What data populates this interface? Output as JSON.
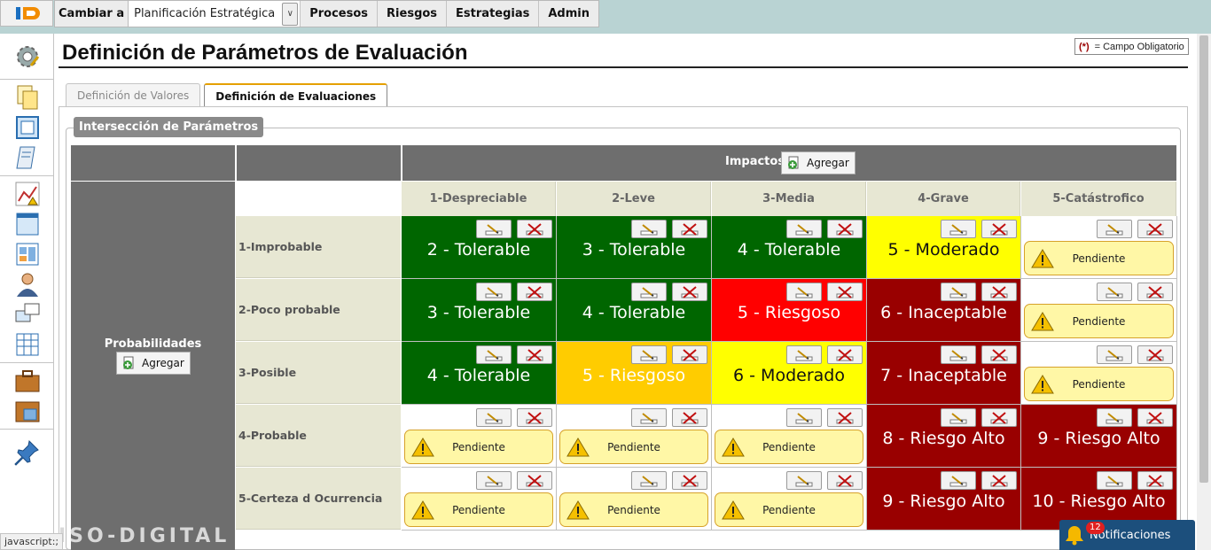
{
  "menu": {
    "cambiar_label": "Cambiar a",
    "selected_plan": "Planificación Estratégica",
    "items": [
      "Procesos",
      "Riesgos",
      "Estrategias",
      "Admin"
    ]
  },
  "page": {
    "title": "Definición de Parámetros de Evaluación",
    "required_marker": "(*)",
    "required_text": "= Campo Obligatorio"
  },
  "tabs": [
    {
      "label": "Definición de Valores",
      "active": false
    },
    {
      "label": "Definición de Evaluaciones",
      "active": true
    }
  ],
  "section": {
    "legend": "Intersección de Parámetros"
  },
  "matrix": {
    "impactos_label": "Impactos",
    "probabilidades_label": "Probabilidades",
    "agregar_label": "Agregar",
    "impactos": [
      "1-Despreciable",
      "2-Leve",
      "3-Media",
      "4-Grave",
      "5-Catástrofico"
    ],
    "probabilidades": [
      "1-Improbable",
      "2-Poco probable",
      "3-Posible",
      "4-Probable",
      "5-Certeza d Ocurrencia"
    ],
    "pending_label": "Pendiente",
    "rows": [
      [
        {
          "text": "2 - Tolerable",
          "bg": "#006600",
          "fg": "#ffffff"
        },
        {
          "text": "3 - Tolerable",
          "bg": "#006600",
          "fg": "#ffffff"
        },
        {
          "text": "4 - Tolerable",
          "bg": "#006600",
          "fg": "#ffffff"
        },
        {
          "text": "5 - Moderado",
          "bg": "#ffff00",
          "fg": "#111111"
        },
        {
          "pending": true
        }
      ],
      [
        {
          "text": "3 - Tolerable",
          "bg": "#006600",
          "fg": "#ffffff"
        },
        {
          "text": "4 - Tolerable",
          "bg": "#006600",
          "fg": "#ffffff"
        },
        {
          "text": "5 - Riesgoso",
          "bg": "#ff0000",
          "fg": "#ffffff"
        },
        {
          "text": "6 - Inaceptable",
          "bg": "#990000",
          "fg": "#ffffff"
        },
        {
          "pending": true
        }
      ],
      [
        {
          "text": "4 - Tolerable",
          "bg": "#006600",
          "fg": "#ffffff"
        },
        {
          "text": "5 - Riesgoso",
          "bg": "#ffcc00",
          "fg": "#ffffff"
        },
        {
          "text": "6 - Moderado",
          "bg": "#ffff00",
          "fg": "#111111"
        },
        {
          "text": "7 - Inaceptable",
          "bg": "#990000",
          "fg": "#ffffff"
        },
        {
          "pending": true
        }
      ],
      [
        {
          "pending": true
        },
        {
          "pending": true
        },
        {
          "pending": true
        },
        {
          "text": "8 - Riesgo Alto",
          "bg": "#990000",
          "fg": "#ffffff"
        },
        {
          "text": "9 - Riesgo Alto",
          "bg": "#990000",
          "fg": "#ffffff"
        }
      ],
      [
        {
          "pending": true
        },
        {
          "pending": true
        },
        {
          "pending": true
        },
        {
          "text": "9 - Riesgo Alto",
          "bg": "#990000",
          "fg": "#ffffff"
        },
        {
          "text": "10 - Riesgo Alto",
          "bg": "#990000",
          "fg": "#ffffff"
        }
      ]
    ]
  },
  "footer": {
    "status_text": "javascript:;",
    "watermark": "ISO-DIGITAL",
    "notifications_label": "Notificaciones",
    "notifications_count": "12"
  }
}
